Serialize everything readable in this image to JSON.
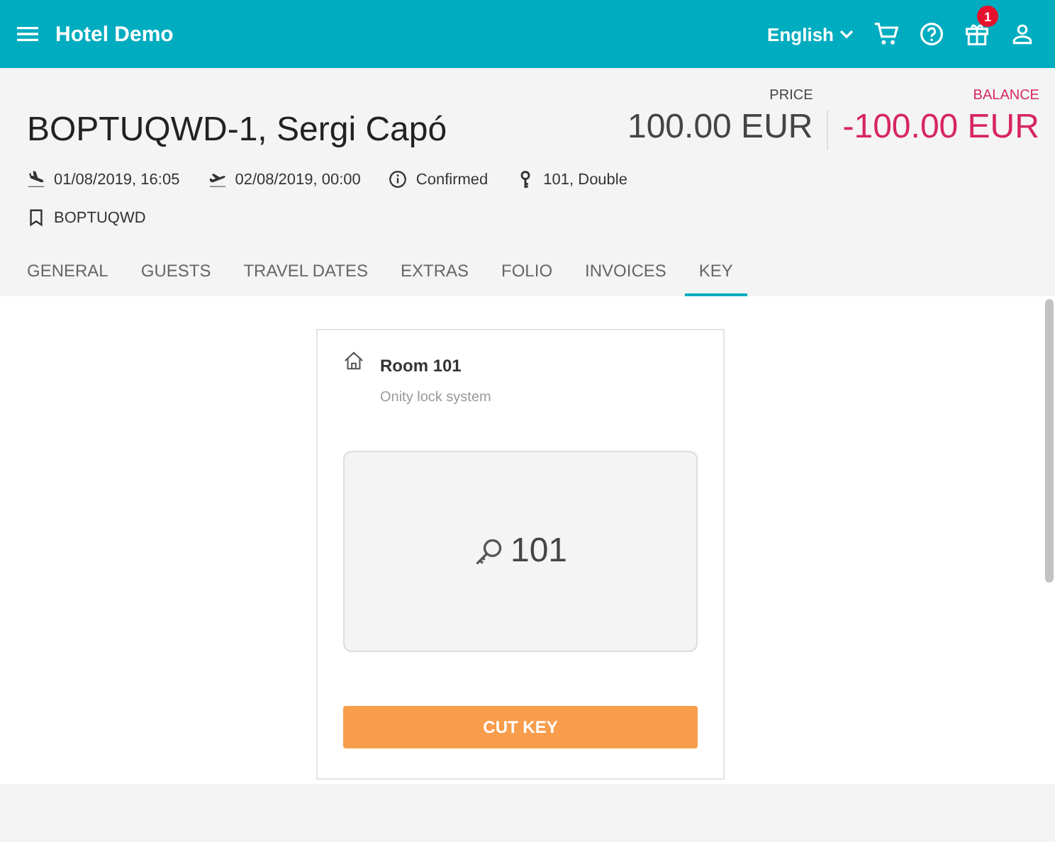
{
  "app_bar": {
    "title": "Hotel Demo",
    "language": "English",
    "notification_count": "1"
  },
  "booking": {
    "title": "BOPTUQWD-1, Sergi Capó",
    "details": [
      {
        "kind": "arrival",
        "text": "01/08/2019, 16:05"
      },
      {
        "kind": "departure",
        "text": "02/08/2019, 00:00"
      },
      {
        "kind": "status",
        "text": "Confirmed"
      },
      {
        "kind": "room",
        "text": "101, Double"
      }
    ],
    "reference": {
      "kind": "bookmark",
      "text": "BOPTUQWD"
    },
    "price": {
      "label": "PRICE",
      "value": "100.00 EUR"
    },
    "balance": {
      "label": "BALANCE",
      "value": "-100.00 EUR"
    }
  },
  "tabs": [
    {
      "label": "GENERAL",
      "selected": false
    },
    {
      "label": "GUESTS",
      "selected": false
    },
    {
      "label": "TRAVEL DATES",
      "selected": false
    },
    {
      "label": "EXTRAS",
      "selected": false
    },
    {
      "label": "FOLIO",
      "selected": false
    },
    {
      "label": "INVOICES",
      "selected": false
    },
    {
      "label": "KEY",
      "selected": true
    }
  ],
  "key_card": {
    "room": "Room 101",
    "lock_system": "Onity lock system",
    "key_number": "101",
    "button": "CUT KEY"
  }
}
